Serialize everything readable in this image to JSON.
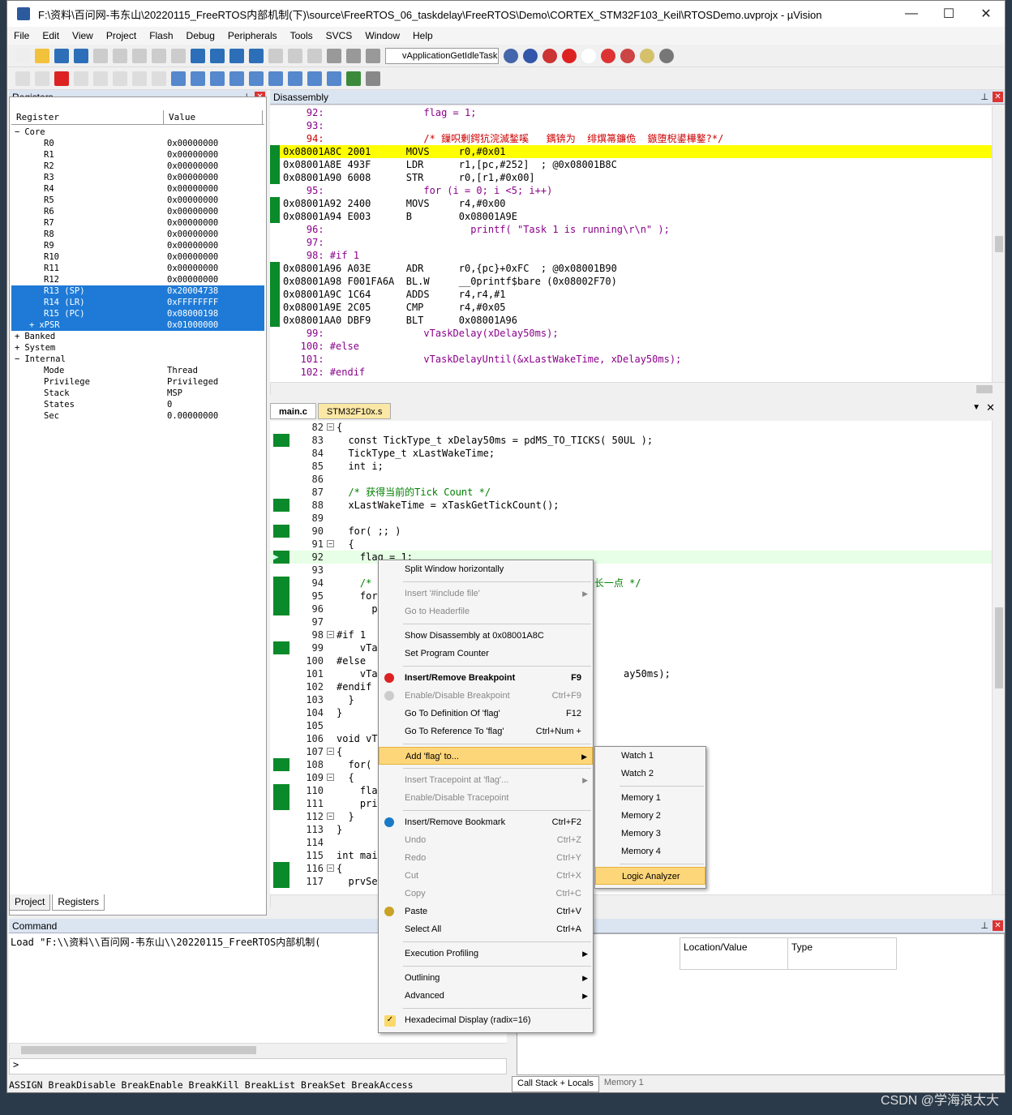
{
  "window": {
    "title": "F:\\资料\\百问网-韦东山\\20220115_FreeRTOS内部机制(下)\\source\\FreeRTOS_06_taskdelay\\FreeRTOS\\Demo\\CORTEX_STM32F103_Keil\\RTOSDemo.uvprojx - µVision"
  },
  "menu": [
    "File",
    "Edit",
    "View",
    "Project",
    "Flash",
    "Debug",
    "Peripherals",
    "Tools",
    "SVCS",
    "Window",
    "Help"
  ],
  "toolbar": {
    "combo": "vApplicationGetIdleTaskM"
  },
  "registers": {
    "title": "Registers",
    "col_register": "Register",
    "col_value": "Value",
    "rows": [
      {
        "name": "Core",
        "value": "",
        "indent": 0,
        "exp": "−",
        "sel": false
      },
      {
        "name": "R0",
        "value": "0x00000000",
        "indent": 2,
        "sel": false
      },
      {
        "name": "R1",
        "value": "0x00000000",
        "indent": 2,
        "sel": false
      },
      {
        "name": "R2",
        "value": "0x00000000",
        "indent": 2,
        "sel": false
      },
      {
        "name": "R3",
        "value": "0x00000000",
        "indent": 2,
        "sel": false
      },
      {
        "name": "R4",
        "value": "0x00000000",
        "indent": 2,
        "sel": false
      },
      {
        "name": "R5",
        "value": "0x00000000",
        "indent": 2,
        "sel": false
      },
      {
        "name": "R6",
        "value": "0x00000000",
        "indent": 2,
        "sel": false
      },
      {
        "name": "R7",
        "value": "0x00000000",
        "indent": 2,
        "sel": false
      },
      {
        "name": "R8",
        "value": "0x00000000",
        "indent": 2,
        "sel": false
      },
      {
        "name": "R9",
        "value": "0x00000000",
        "indent": 2,
        "sel": false
      },
      {
        "name": "R10",
        "value": "0x00000000",
        "indent": 2,
        "sel": false
      },
      {
        "name": "R11",
        "value": "0x00000000",
        "indent": 2,
        "sel": false
      },
      {
        "name": "R12",
        "value": "0x00000000",
        "indent": 2,
        "sel": false
      },
      {
        "name": "R13 (SP)",
        "value": "0x20004738",
        "indent": 2,
        "sel": true
      },
      {
        "name": "R14 (LR)",
        "value": "0xFFFFFFFF",
        "indent": 2,
        "sel": true
      },
      {
        "name": "R15 (PC)",
        "value": "0x08000198",
        "indent": 2,
        "sel": true
      },
      {
        "name": "xPSR",
        "value": "0x01000000",
        "indent": 1,
        "exp": "+",
        "sel": true
      },
      {
        "name": "Banked",
        "value": "",
        "indent": 0,
        "exp": "+",
        "sel": false
      },
      {
        "name": "System",
        "value": "",
        "indent": 0,
        "exp": "+",
        "sel": false
      },
      {
        "name": "Internal",
        "value": "",
        "indent": 0,
        "exp": "−",
        "sel": false
      },
      {
        "name": "Mode",
        "value": "Thread",
        "indent": 2,
        "sel": false
      },
      {
        "name": "Privilege",
        "value": "Privileged",
        "indent": 2,
        "sel": false
      },
      {
        "name": "Stack",
        "value": "MSP",
        "indent": 2,
        "sel": false
      },
      {
        "name": "States",
        "value": "0",
        "indent": 2,
        "sel": false
      },
      {
        "name": "Sec",
        "value": "0.00000000",
        "indent": 2,
        "sel": false
      }
    ],
    "tab_project": "Project",
    "tab_registers": "Registers"
  },
  "disassembly": {
    "title": "Disassembly",
    "lines": [
      {
        "t": "    92:                 flag = 1;",
        "k": "src"
      },
      {
        "t": "    93:",
        "k": "src"
      },
      {
        "t": "    94:                 /* 鏁呮剰鍔犺浣滅鍫嗘   鍝锛为  绯熼箒鐮佹  鏃堕棿鍙樺鐜?*/",
        "k": "cm"
      },
      {
        "t": "0x08001A8C 2001      MOVS     r0,#0x01",
        "k": "hl",
        "g": 1
      },
      {
        "t": "0x08001A8E 493F      LDR      r1,[pc,#252]  ; @0x08001B8C",
        "k": "",
        "g": 1
      },
      {
        "t": "0x08001A90 6008      STR      r0,[r1,#0x00]",
        "k": "",
        "g": 1
      },
      {
        "t": "    95:                 for (i = 0; i <5; i++)",
        "k": "src"
      },
      {
        "t": "0x08001A92 2400      MOVS     r4,#0x00",
        "k": "",
        "g": 1
      },
      {
        "t": "0x08001A94 E003      B        0x08001A9E",
        "k": "",
        "g": 1
      },
      {
        "t": "    96:                         printf( \"Task 1 is running\\r\\n\" );",
        "k": "src"
      },
      {
        "t": "    97:",
        "k": "src"
      },
      {
        "t": "    98: #if 1",
        "k": "src"
      },
      {
        "t": "0x08001A96 A03E      ADR      r0,{pc}+0xFC  ; @0x08001B90",
        "k": "",
        "g": 1
      },
      {
        "t": "0x08001A98 F001FA6A  BL.W     __0printf$bare (0x08002F70)",
        "k": "",
        "g": 1
      },
      {
        "t": "0x08001A9C 1C64      ADDS     r4,r4,#1",
        "k": "",
        "g": 1
      },
      {
        "t": "0x08001A9E 2C05      CMP      r4,#0x05",
        "k": "",
        "g": 1
      },
      {
        "t": "0x08001AA0 DBF9      BLT      0x08001A96",
        "k": "",
        "g": 1
      },
      {
        "t": "    99:                 vTaskDelay(xDelay50ms);",
        "k": "src"
      },
      {
        "t": "   100: #else",
        "k": "src"
      },
      {
        "t": "   101:                 vTaskDelayUntil(&xLastWakeTime, xDelay50ms);",
        "k": "src"
      },
      {
        "t": "   102: #endif",
        "k": "src"
      }
    ]
  },
  "editor": {
    "tabs": [
      "main.c",
      "STM32F10x.s"
    ],
    "lines": [
      {
        "n": "82",
        "c": "{",
        "f": "−",
        "g": 0
      },
      {
        "n": "83",
        "c": "  const TickType_t xDelay50ms = pdMS_TO_TICKS( 50UL );",
        "g": 1
      },
      {
        "n": "84",
        "c": "  TickType_t xLastWakeTime;",
        "g": 0
      },
      {
        "n": "85",
        "c": "  int i;",
        "g": 0
      },
      {
        "n": "86",
        "c": "",
        "g": 0
      },
      {
        "n": "87",
        "c": "  /* 获得当前的Tick Count */",
        "g": 0,
        "cmt": 1
      },
      {
        "n": "88",
        "c": "  xLastWakeTime = xTaskGetTickCount();",
        "g": 1
      },
      {
        "n": "89",
        "c": "",
        "g": 0
      },
      {
        "n": "90",
        "c": "  for( ;; )",
        "g": 1
      },
      {
        "n": "91",
        "c": "  {",
        "f": "−",
        "g": 0
      },
      {
        "n": "92",
        "c": "    flag = 1;",
        "g": 2,
        "cur": 1
      },
      {
        "n": "93",
        "c": "",
        "g": 0
      },
      {
        "n": "94",
        "c": "    /*                                      长一点 */",
        "g": 1,
        "cmt": 1
      },
      {
        "n": "95",
        "c": "    for",
        "g": 1
      },
      {
        "n": "96",
        "c": "      p",
        "g": 1
      },
      {
        "n": "97",
        "c": "",
        "g": 0
      },
      {
        "n": "98",
        "c": "#if 1",
        "f": "−",
        "g": 0
      },
      {
        "n": "99",
        "c": "    vTa",
        "g": 1
      },
      {
        "n": "100",
        "c": "#else",
        "g": 0
      },
      {
        "n": "101",
        "c": "    vTa                                          ay50ms);",
        "g": 0
      },
      {
        "n": "102",
        "c": "#endif",
        "g": 0
      },
      {
        "n": "103",
        "c": "  }",
        "g": 0
      },
      {
        "n": "104",
        "c": "}",
        "g": 0
      },
      {
        "n": "105",
        "c": "",
        "g": 0
      },
      {
        "n": "106",
        "c": "void vT",
        "g": 0
      },
      {
        "n": "107",
        "c": "{",
        "f": "−",
        "g": 0
      },
      {
        "n": "108",
        "c": "  for(",
        "g": 1
      },
      {
        "n": "109",
        "c": "  {",
        "f": "−",
        "g": 0
      },
      {
        "n": "110",
        "c": "    fla",
        "g": 1
      },
      {
        "n": "111",
        "c": "    pri",
        "g": 1
      },
      {
        "n": "112",
        "c": "  }",
        "f": "−",
        "g": 0
      },
      {
        "n": "113",
        "c": "}",
        "g": 0
      },
      {
        "n": "114",
        "c": "",
        "g": 0
      },
      {
        "n": "115",
        "c": "int mai",
        "g": 0
      },
      {
        "n": "116",
        "c": "{",
        "f": "−",
        "g": 1
      },
      {
        "n": "117",
        "c": "  prvSe",
        "g": 1
      }
    ]
  },
  "context_menu": [
    {
      "label": "Split Window horizontally"
    },
    {
      "sep": 1
    },
    {
      "label": "Insert '#include file'",
      "dis": 1,
      "arr": 1
    },
    {
      "label": "Go to Headerfile",
      "dis": 1
    },
    {
      "sep": 1
    },
    {
      "label": "Show Disassembly at 0x08001A8C"
    },
    {
      "label": "Set Program Counter"
    },
    {
      "sep": 1
    },
    {
      "label": "Insert/Remove Breakpoint",
      "sc": "F9",
      "bold": 1,
      "icon": "#d22"
    },
    {
      "label": "Enable/Disable Breakpoint",
      "sc": "Ctrl+F9",
      "dis": 1,
      "icon": "#ccc"
    },
    {
      "label": "Go To Definition Of 'flag'",
      "sc": "F12"
    },
    {
      "label": "Go To Reference To 'flag'",
      "sc": "Ctrl+Num +"
    },
    {
      "sep": 1
    },
    {
      "label": "Add 'flag' to...",
      "arr": 1,
      "hov": 1
    },
    {
      "sep": 1
    },
    {
      "label": "Insert Tracepoint at 'flag'...",
      "dis": 1,
      "arr": 1
    },
    {
      "label": "Enable/Disable Tracepoint",
      "dis": 1
    },
    {
      "sep": 1
    },
    {
      "label": "Insert/Remove Bookmark",
      "sc": "Ctrl+F2",
      "icon": "#1a7ac8"
    },
    {
      "label": "Undo",
      "sc": "Ctrl+Z",
      "dis": 1
    },
    {
      "label": "Redo",
      "sc": "Ctrl+Y",
      "dis": 1
    },
    {
      "label": "Cut",
      "sc": "Ctrl+X",
      "dis": 1
    },
    {
      "label": "Copy",
      "sc": "Ctrl+C",
      "dis": 1
    },
    {
      "label": "Paste",
      "sc": "Ctrl+V",
      "icon": "#c9a227"
    },
    {
      "label": "Select All",
      "sc": "Ctrl+A"
    },
    {
      "sep": 1
    },
    {
      "label": "Execution Profiling",
      "arr": 1
    },
    {
      "sep": 1
    },
    {
      "label": "Outlining",
      "arr": 1
    },
    {
      "label": "Advanced",
      "arr": 1
    },
    {
      "sep": 1
    },
    {
      "label": "Hexadecimal Display (radix=16)",
      "check": 1
    }
  ],
  "submenu": [
    {
      "label": "Watch 1"
    },
    {
      "label": "Watch 2"
    },
    {
      "sep": 1
    },
    {
      "label": "Memory 1"
    },
    {
      "label": "Memory 2"
    },
    {
      "label": "Memory 3"
    },
    {
      "label": "Memory 4"
    },
    {
      "sep": 1
    },
    {
      "label": "Logic Analyzer",
      "hov": 1
    }
  ],
  "command": {
    "title": "Command",
    "text": "Load \"F:\\\\资料\\\\百问网-韦东山\\\\20220115_FreeRTOS内部机制(",
    "prompt": ">",
    "status": "ASSIGN BreakDisable BreakEnable BreakKill BreakList BreakSet BreakAccess"
  },
  "watch": {
    "col_location": "Location/Value",
    "col_type": "Type",
    "tab_callstack": "Call Stack + Locals",
    "tab_memory": "Memory 1"
  },
  "watermark": "CSDN @学海浪太大"
}
